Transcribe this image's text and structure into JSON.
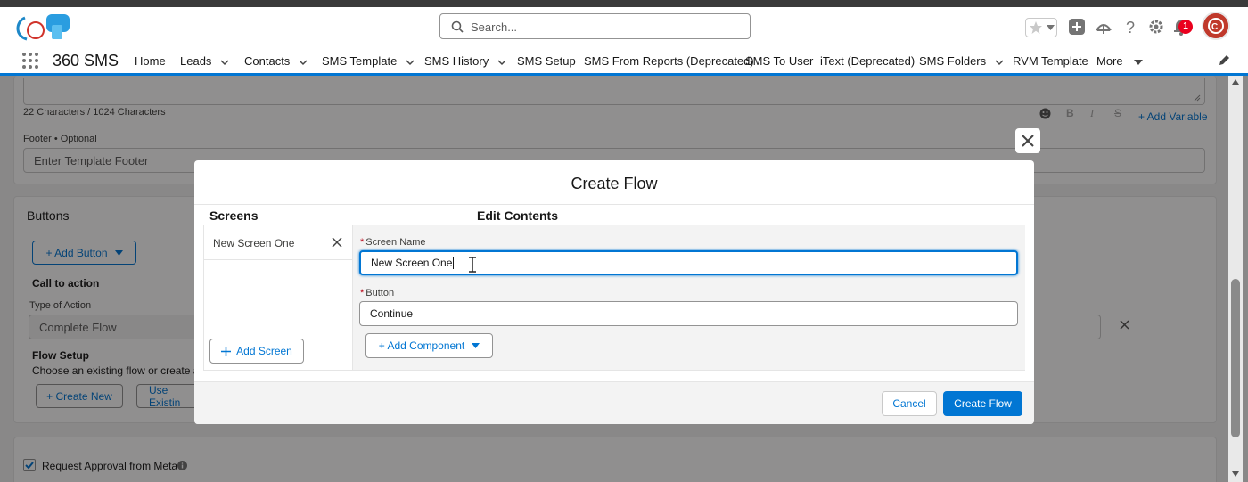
{
  "header": {
    "search_placeholder": "Search...",
    "notification_count": "1"
  },
  "nav": {
    "app_name": "360 SMS",
    "items": [
      {
        "label": "Home",
        "has_menu": false
      },
      {
        "label": "Leads",
        "has_menu": true
      },
      {
        "label": "Contacts",
        "has_menu": true
      },
      {
        "label": "SMS Template",
        "has_menu": true
      },
      {
        "label": "SMS History",
        "has_menu": true
      },
      {
        "label": "SMS Setup",
        "has_menu": false
      },
      {
        "label": "SMS From Reports (Deprecated)",
        "has_menu": false
      },
      {
        "label": "SMS To User",
        "has_menu": false
      },
      {
        "label": "iText (Deprecated)",
        "has_menu": false
      },
      {
        "label": "SMS Folders",
        "has_menu": true
      },
      {
        "label": "RVM Template",
        "has_menu": false
      },
      {
        "label": "More",
        "has_menu": true
      }
    ]
  },
  "background": {
    "char_count": "22 Characters / 1024 Characters",
    "add_variable": "+ Add Variable",
    "footer_label": "Footer • Optional",
    "footer_placeholder": "Enter Template Footer",
    "buttons_title": "Buttons",
    "add_button": "+ Add Button",
    "call_to_action": "Call to action",
    "type_of_action_label": "Type of Action",
    "type_of_action_value": "Complete Flow",
    "flow_setup_title": "Flow Setup",
    "flow_setup_desc": "Choose an existing flow or create a n",
    "create_new": "+ Create New",
    "use_existing": "Use Existin",
    "request_approval": "Request Approval from Meta"
  },
  "modal": {
    "title": "Create Flow",
    "screens_header": "Screens",
    "edit_header": "Edit Contents",
    "screens": [
      "New Screen One"
    ],
    "add_screen": "Add Screen",
    "screen_name_label": "Screen Name",
    "screen_name_value": "New Screen One",
    "button_label": "Button",
    "button_value": "Continue",
    "add_component": "+ Add Component",
    "cancel": "Cancel",
    "create_flow": "Create Flow"
  },
  "colors": {
    "brand": "#0176d3",
    "required": "#ba0517",
    "badge": "#ea001e"
  }
}
